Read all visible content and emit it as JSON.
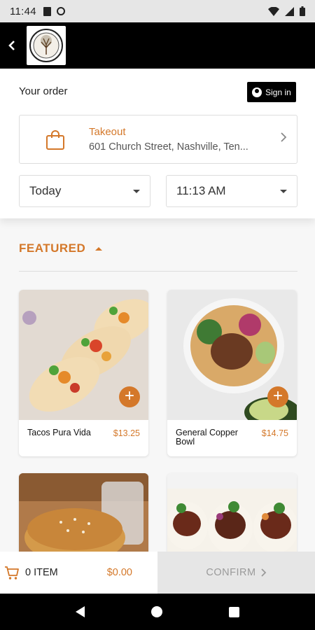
{
  "status_bar": {
    "time": "11:44"
  },
  "header": {
    "your_order": "Your order",
    "sign_in": "Sign in"
  },
  "takeout": {
    "label": "Takeout",
    "address": "601 Church Street, Nashville, Ten..."
  },
  "selects": {
    "day": "Today",
    "time": "11:13 AM"
  },
  "featured": {
    "title": "FEATURED",
    "items": [
      {
        "name": "Tacos Pura Vida",
        "price": "$13.25"
      },
      {
        "name": "General Copper Bowl",
        "price": "$14.75"
      },
      {
        "name": "",
        "price": ""
      },
      {
        "name": "",
        "price": ""
      }
    ]
  },
  "cart": {
    "count": "0 ITEM",
    "total": "$0.00",
    "confirm": "CONFIRM"
  },
  "icons": {
    "back": "arrow-back-icon",
    "bag": "shopping-bag-icon",
    "cart": "shopping-cart-icon",
    "person": "person-icon"
  },
  "colors": {
    "accent": "#d4782a",
    "app_bar": "#000000",
    "confirm_bg": "#e6e6e6"
  }
}
